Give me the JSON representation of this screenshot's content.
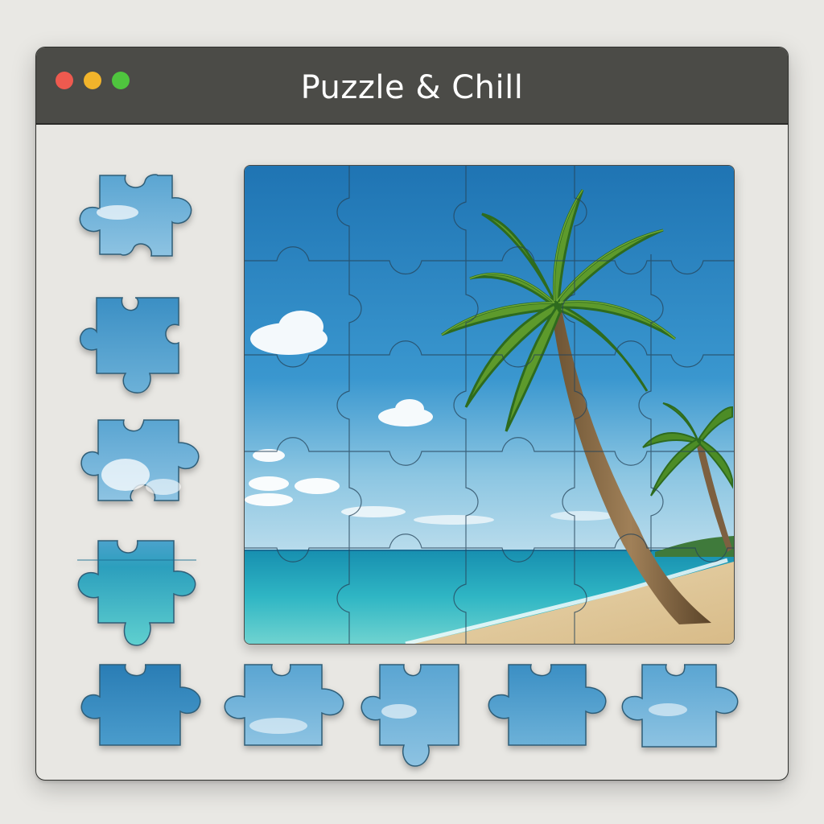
{
  "window": {
    "title": "Puzzle & Chill"
  },
  "board": {
    "grid": "5x5",
    "image": "tropical-beach-palm-tree"
  },
  "tray_pieces": [
    {
      "id": "piece-1",
      "scene": "sky-cloud"
    },
    {
      "id": "piece-2",
      "scene": "sky"
    },
    {
      "id": "piece-3",
      "scene": "sky-clouds"
    },
    {
      "id": "piece-4",
      "scene": "sea-horizon"
    },
    {
      "id": "piece-5",
      "scene": "sky-dark"
    },
    {
      "id": "piece-6",
      "scene": "sky-haze"
    },
    {
      "id": "piece-7",
      "scene": "sky-cloud"
    },
    {
      "id": "piece-8",
      "scene": "sky"
    },
    {
      "id": "piece-9",
      "scene": "sky-cloud"
    }
  ],
  "colors": {
    "titlebar": "#4b4b47",
    "window_bg": "#e8e7e3",
    "close": "#ee5a4f",
    "minimize": "#f2b42b",
    "maximize": "#4fc53e"
  }
}
